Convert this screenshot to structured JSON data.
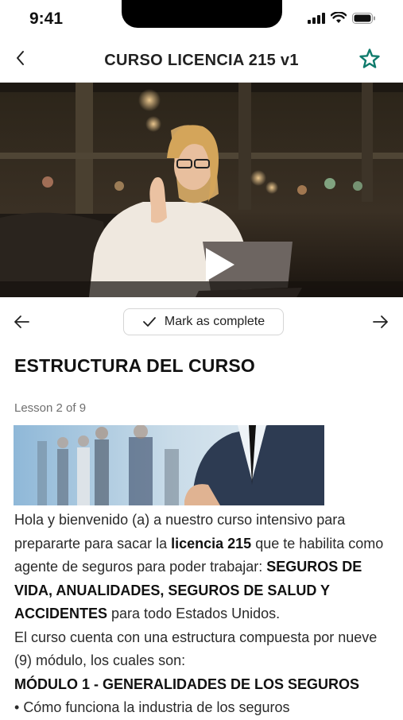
{
  "status_bar": {
    "time": "9:41"
  },
  "header": {
    "title": "CURSO LICENCIA 215 v1"
  },
  "video": {
    "description_icon": "play-icon"
  },
  "controls": {
    "mark_complete_label": "Mark as complete"
  },
  "lesson": {
    "section_title": "ESTRUCTURA DEL CURSO",
    "count": "Lesson 2 of 9",
    "p1_a": "Hola y bienvenido (a) a nuestro curso intensivo para prepararte para sacar la ",
    "p1_b": "licencia 215",
    "p1_c": " que te habilita como agente de seguros para poder trabajar: ",
    "p1_d": "SEGUROS DE VIDA, ANUALIDADES, SEGUROS DE SALUD Y ACCIDENTES",
    "p1_e": " para todo Estados Unidos.",
    "p2": "El curso cuenta con una estructura compuesta por nueve (9) módulo, los cuales son:",
    "module1": "MÓDULO 1 - GENERALIDADES DE LOS SEGUROS",
    "bullet1": "Cómo funciona la industria de los seguros"
  },
  "colors": {
    "accent": "#0f7b6c",
    "divider": "#e3e3e3"
  }
}
